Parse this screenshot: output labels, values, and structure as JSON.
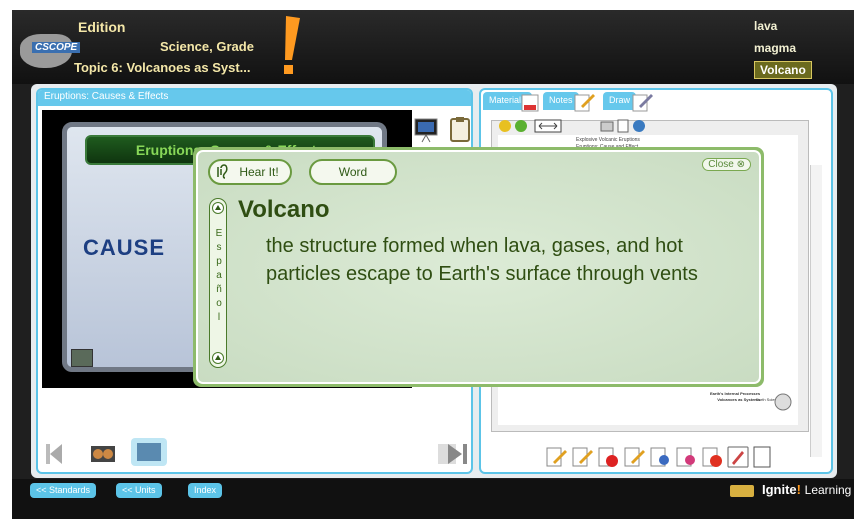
{
  "header": {
    "edition": "Edition",
    "course": "Science, Grade",
    "topic": "Topic 6: Volcanoes as Syst...",
    "logo_text": "CSCOPE",
    "words": [
      "lava",
      "magma",
      "Volcano"
    ]
  },
  "left_panel": {
    "title": "Eruptions: Causes & Effects",
    "slide_title": "Eruptions: Causes & Effects",
    "slide_text": "CAUSE"
  },
  "right_panel": {
    "tabs": [
      "Materials",
      "Notes",
      "Draw"
    ],
    "doc_lines": [
      "Explosive Volcanic Eruptions",
      "Eruptions: Cause and Effect"
    ],
    "doc_footer": [
      "Earth's Internal Processes",
      "Volcanoes as Systems",
      "Earth Science"
    ]
  },
  "popup": {
    "hear_label": "Hear It!",
    "word_label": "Word",
    "close_label": "Close",
    "espanol": [
      "E",
      "s",
      "p",
      "a",
      "ñ",
      "o",
      "l"
    ],
    "term": "Volcano",
    "definition": "the structure formed when lava, gases, and hot particles escape to Earth's surface through vents"
  },
  "footer": {
    "buttons": [
      "<< Standards",
      "<< Units",
      "Index"
    ],
    "brand": "Ignite",
    "brand_bang": "!",
    "brand_tail": "Learning"
  },
  "colors": {
    "accent_blue": "#5cc4e8",
    "header_text": "#f4e7a8",
    "popup_green": "#8dbb6a",
    "term_color": "#2f4e12"
  }
}
